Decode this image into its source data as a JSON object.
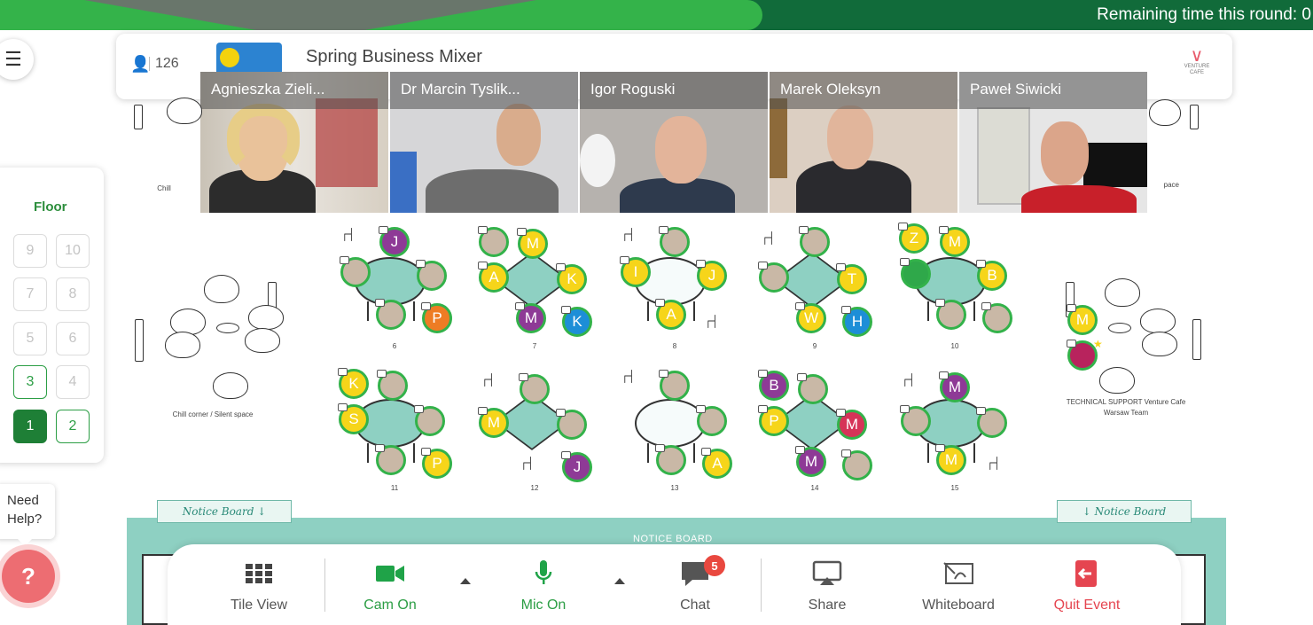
{
  "timer": {
    "text": "Remaining time this round: 0"
  },
  "header": {
    "participant_count": "126",
    "event_title": "Spring Business Mixer",
    "event_logo_text": "Spring Business Mixer",
    "brand_name": "VENTURE CAFE"
  },
  "videos": [
    {
      "name": "Agnieszka Zieli..."
    },
    {
      "name": "Dr Marcin Tyslik..."
    },
    {
      "name": "Igor Roguski"
    },
    {
      "name": "Marek Oleksyn"
    },
    {
      "name": "Paweł Siwicki"
    }
  ],
  "floor_panel": {
    "label": "Floor",
    "floors": [
      "9",
      "10",
      "7",
      "8",
      "5",
      "6",
      "3",
      "4",
      "1",
      "2"
    ],
    "active_floor": "1",
    "available_floors": [
      "1",
      "2",
      "3"
    ]
  },
  "help": {
    "text_line1": "Need",
    "text_line2": "Help?",
    "icon": "question-chat-icon"
  },
  "tables": [
    {
      "number": "6",
      "seats": [
        "J",
        "",
        "",
        "",
        "P"
      ]
    },
    {
      "number": "7",
      "seats": [
        "",
        "M",
        "A",
        "K",
        "M",
        "K"
      ]
    },
    {
      "number": "8",
      "seats": [
        "",
        "I",
        "J",
        "A"
      ]
    },
    {
      "number": "9",
      "seats": [
        "",
        "",
        "T",
        "W",
        "H"
      ]
    },
    {
      "number": "10",
      "seats": [
        "Z",
        "M",
        "",
        "B",
        "",
        ""
      ]
    },
    {
      "number": "11",
      "seats": [
        "K",
        "",
        "S",
        "",
        "",
        "P"
      ]
    },
    {
      "number": "12",
      "seats": [
        "",
        "M",
        "",
        "J"
      ]
    },
    {
      "number": "13",
      "seats": [
        "",
        "",
        "",
        "A"
      ]
    },
    {
      "number": "14",
      "seats": [
        "B",
        "",
        "P",
        "M",
        "M",
        ""
      ]
    },
    {
      "number": "15",
      "seats": [
        "M",
        "",
        "",
        "M"
      ]
    }
  ],
  "lounges": {
    "chill_left_label": "Chill corner / Silent space",
    "chill_top_left_label": "Chill",
    "chill_top_right_label": "pace",
    "support_label_line1": "TECHNICAL SUPPORT Venture Cafe",
    "support_label_line2": "Warsaw Team",
    "support_seat": "M"
  },
  "notice_board": {
    "title": "NOTICE BOARD",
    "left_tab": "Notice Board ↓",
    "right_tab": "↓ Notice Board"
  },
  "toolbar": {
    "tile_view": "Tile View",
    "cam": "Cam On",
    "mic": "Mic On",
    "chat": "Chat",
    "chat_badge": "5",
    "share": "Share",
    "whiteboard": "Whiteboard",
    "quit": "Quit Event"
  },
  "colors": {
    "timer_dark": "#116b3a",
    "timer_light": "#34b34a",
    "accent_green": "#2c9e45",
    "table_teal": "#8ed0c2",
    "quit_red": "#e54550"
  }
}
